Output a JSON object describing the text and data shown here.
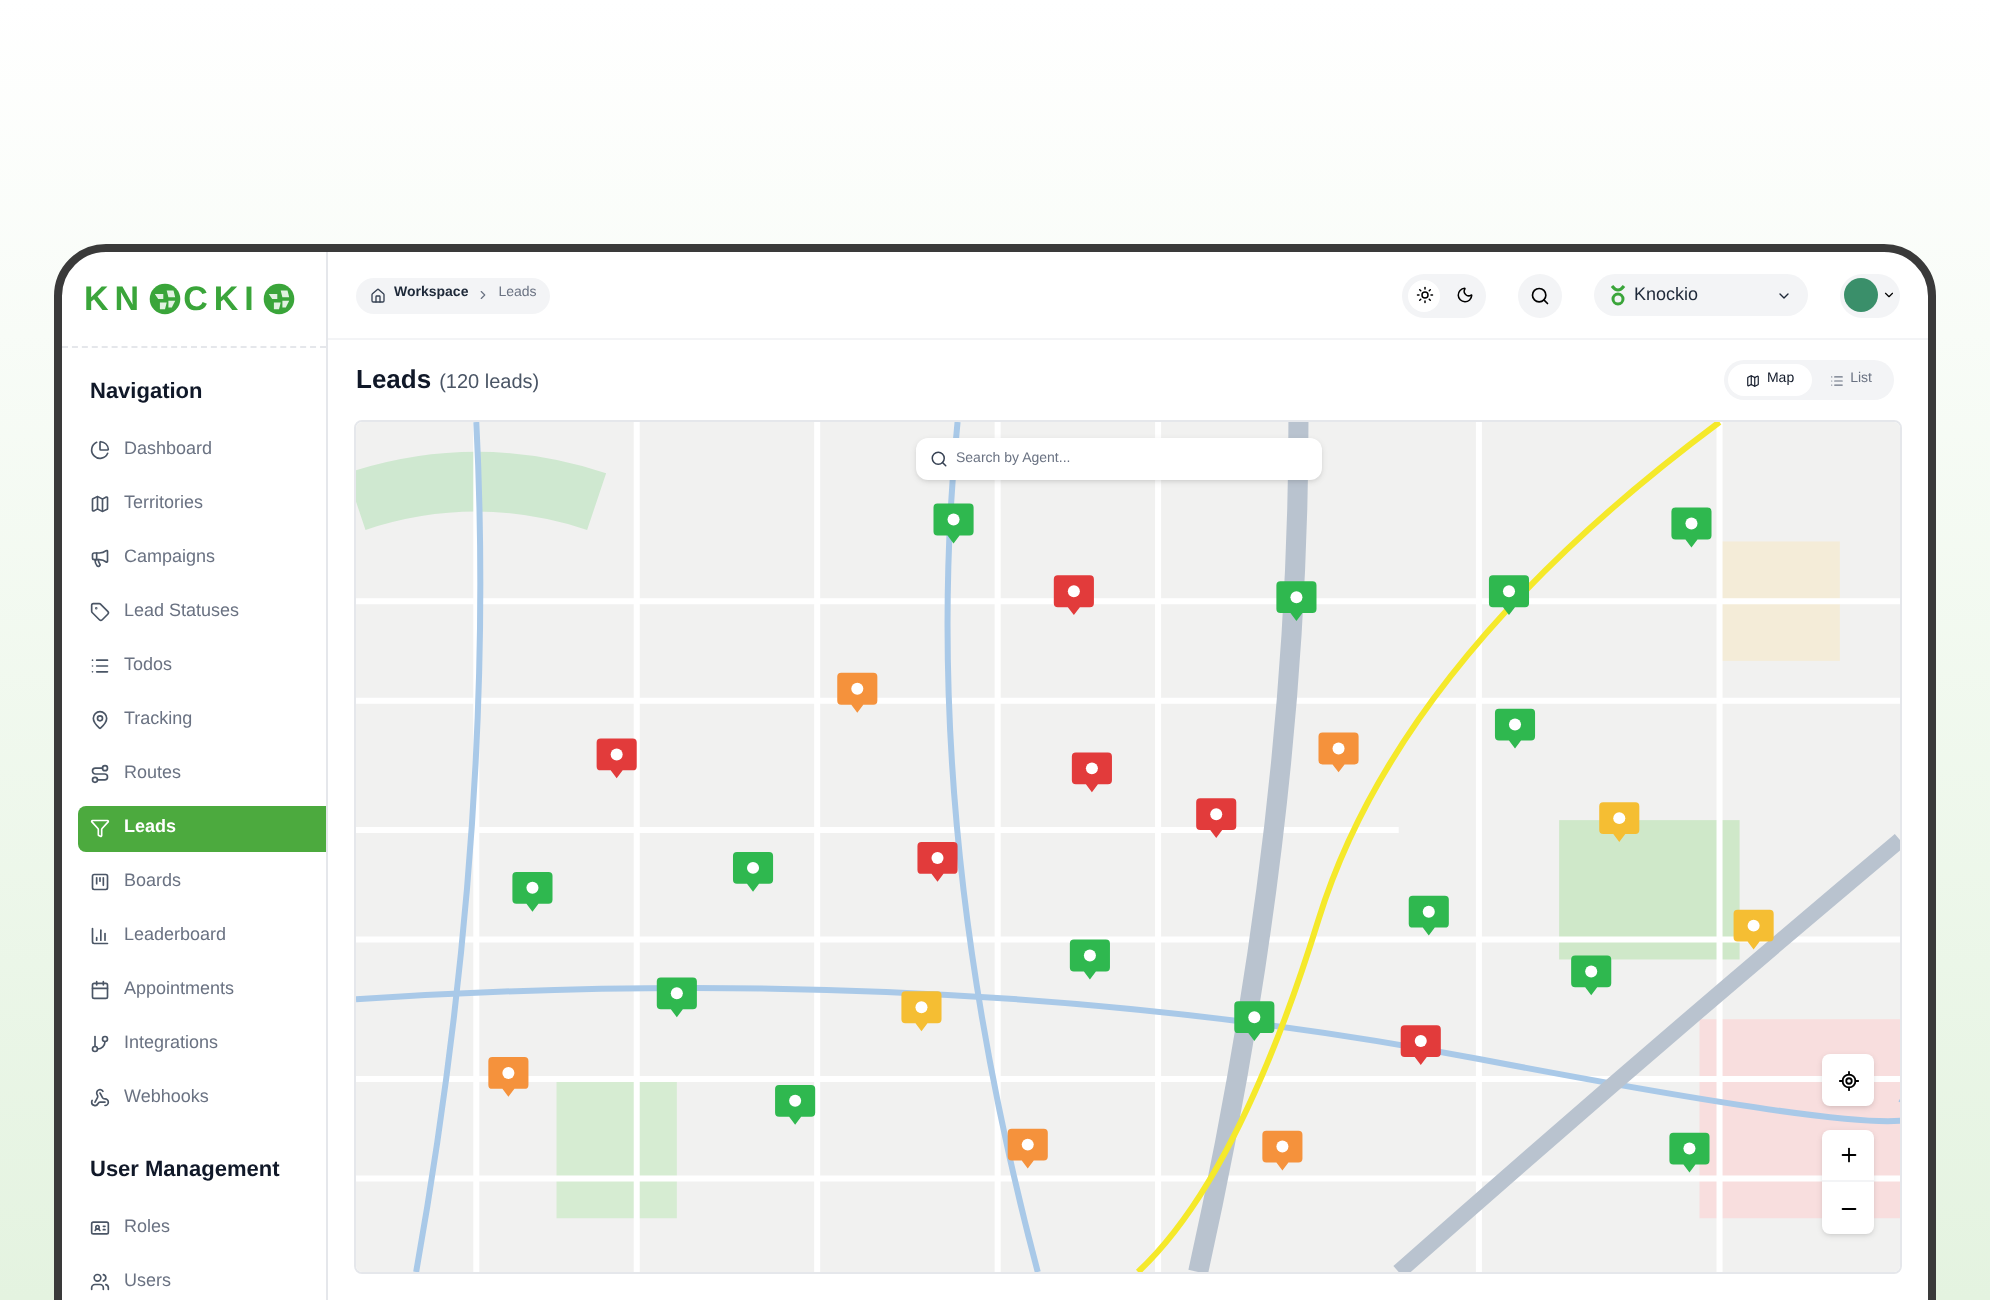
{
  "logo": {
    "part_1": "KN",
    "part_2": "CKI"
  },
  "sidebar": {
    "sections": [
      {
        "title": "Navigation",
        "items": [
          {
            "label": "Dashboard",
            "selected": false
          },
          {
            "label": "Territories",
            "selected": false
          },
          {
            "label": "Campaigns",
            "selected": false
          },
          {
            "label": "Lead Statuses",
            "selected": false
          },
          {
            "label": "Todos",
            "selected": false
          },
          {
            "label": "Tracking",
            "selected": false
          },
          {
            "label": "Routes",
            "selected": false
          },
          {
            "label": "Leads",
            "selected": true
          },
          {
            "label": "Boards",
            "selected": false
          },
          {
            "label": "Leaderboard",
            "selected": false
          },
          {
            "label": "Appointments",
            "selected": false
          },
          {
            "label": "Integrations",
            "selected": false
          },
          {
            "label": "Webhooks",
            "selected": false
          }
        ]
      },
      {
        "title": "User Management",
        "items": [
          {
            "label": "Roles",
            "selected": false
          },
          {
            "label": "Users",
            "selected": false
          }
        ]
      }
    ]
  },
  "breadcrumb": [
    "Workspace",
    "Leads"
  ],
  "theme": {
    "dark": false
  },
  "workspace": {
    "name": "Knockio"
  },
  "page": {
    "title": "Leads",
    "count": "(120 leads)"
  },
  "views": [
    {
      "label": "Map",
      "selected": true
    },
    {
      "label": "List",
      "selected": false
    }
  ],
  "map": {
    "search": {
      "placeholder": "Search by Agent..."
    }
  }
}
